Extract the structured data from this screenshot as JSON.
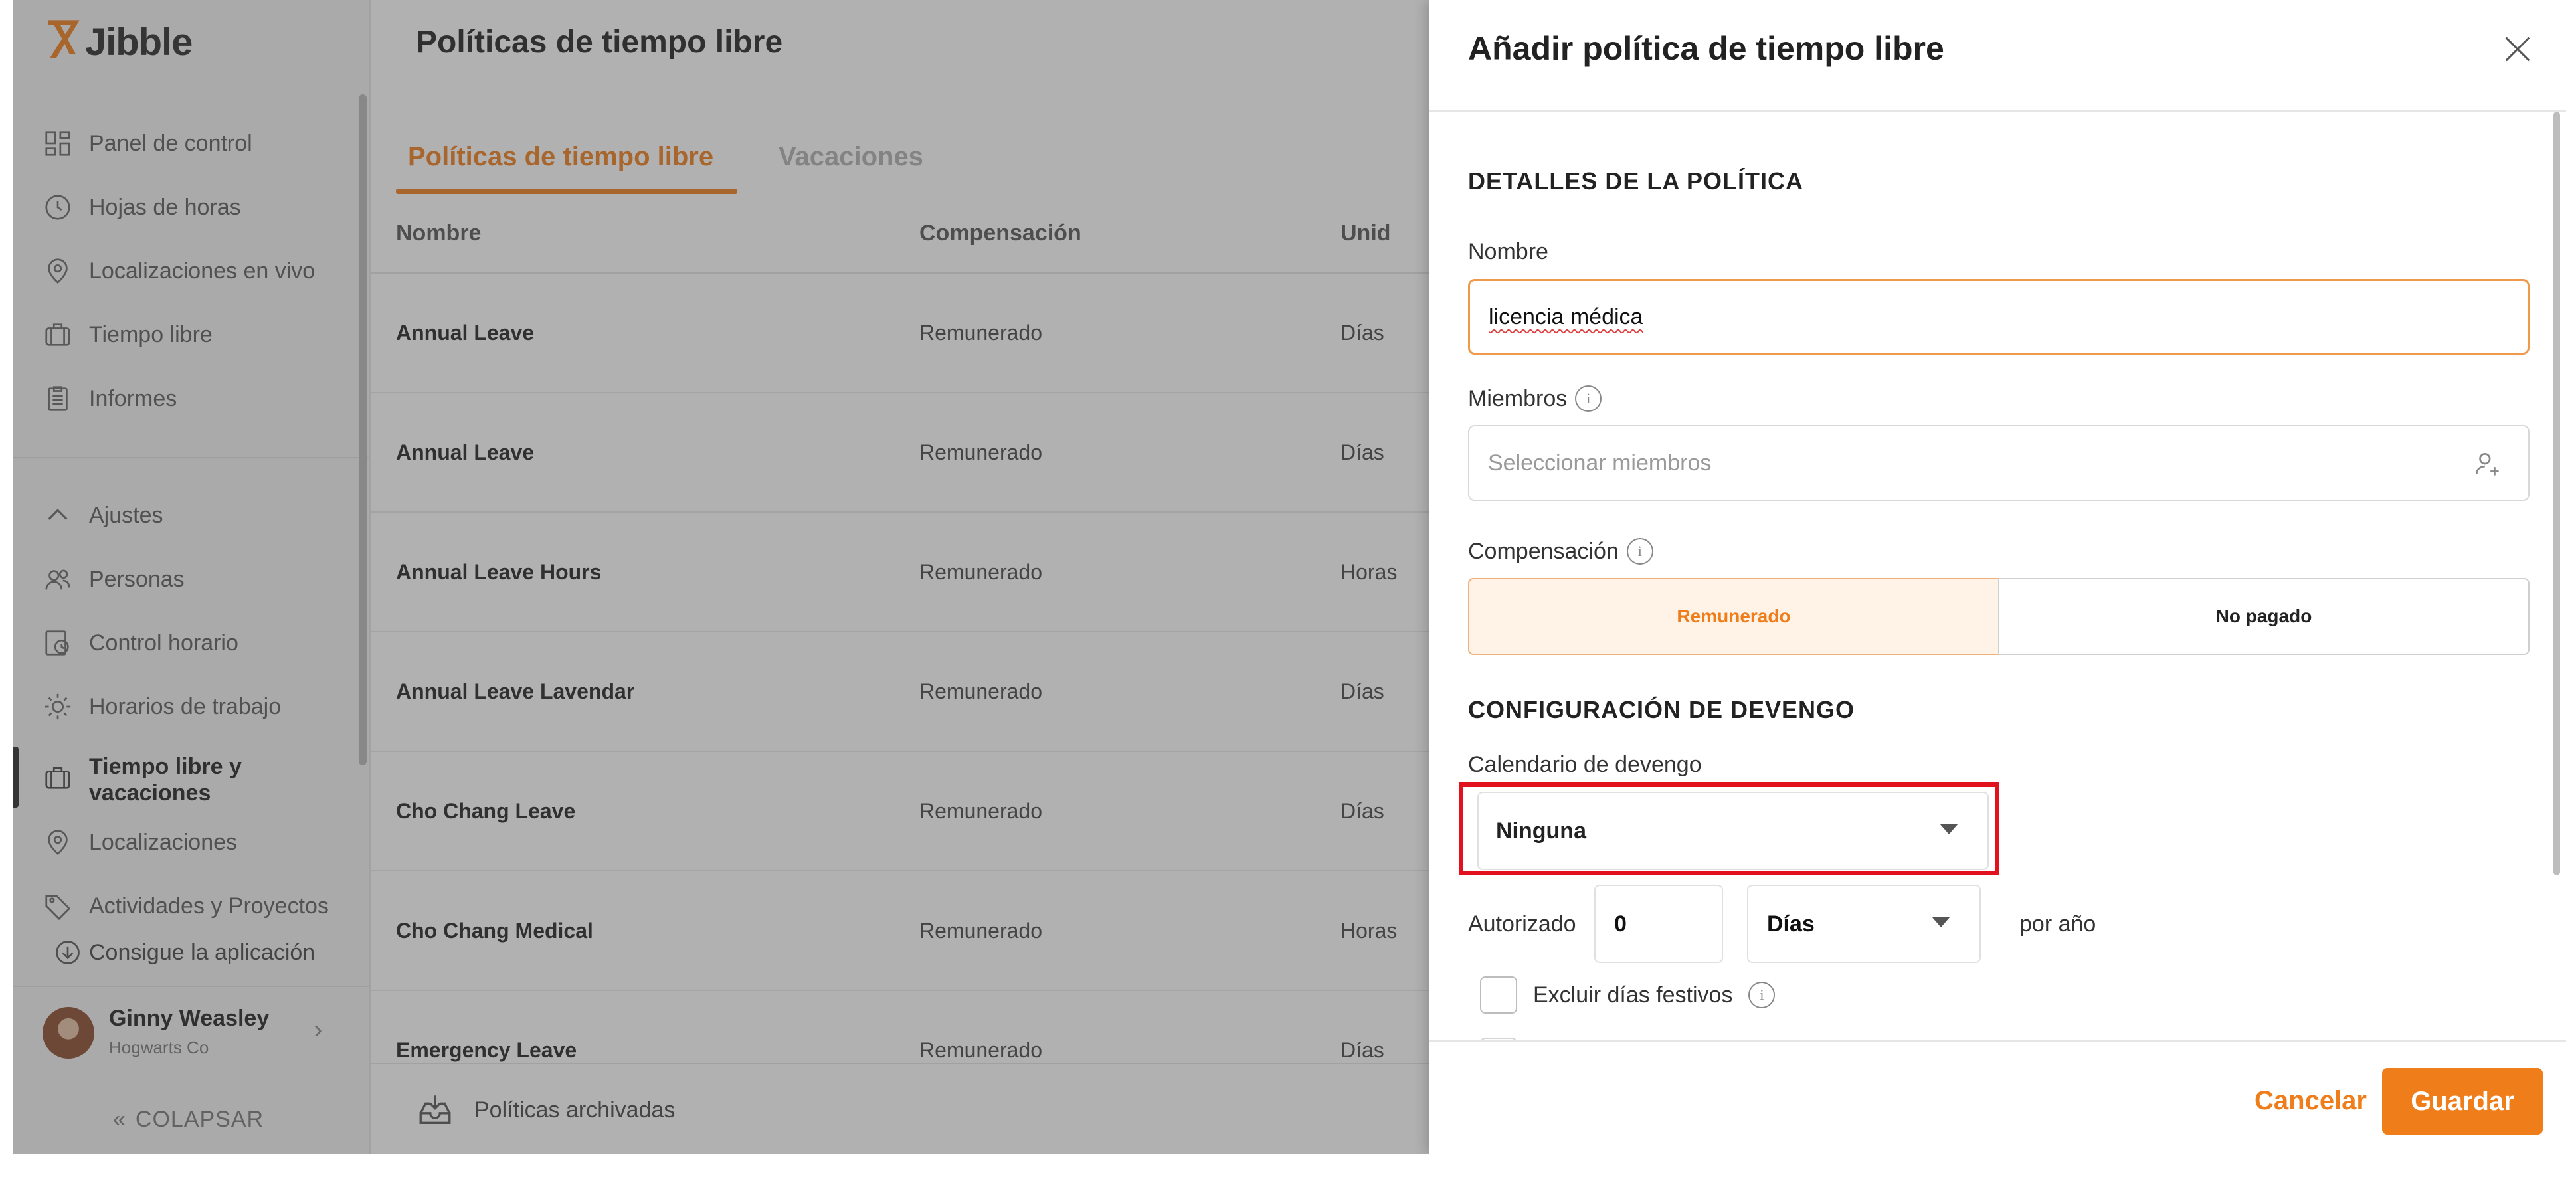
{
  "app": {
    "brand": "Jibble",
    "brand_mark": "Ⴟ"
  },
  "sidebar": {
    "items_top": [
      {
        "label": "Panel de control",
        "icon": "dashboard-icon"
      },
      {
        "label": "Hojas de horas",
        "icon": "clock-icon"
      },
      {
        "label": "Localizaciones en vivo",
        "icon": "location-pin-icon"
      },
      {
        "label": "Tiempo libre",
        "icon": "suitcase-icon"
      },
      {
        "label": "Informes",
        "icon": "clipboard-icon"
      }
    ],
    "settings_label": "Ajustes",
    "items_settings": [
      {
        "label": "Personas",
        "icon": "people-icon"
      },
      {
        "label": "Control horario",
        "icon": "time-tracking-icon"
      },
      {
        "label": "Horarios de trabajo",
        "icon": "sun-schedule-icon"
      },
      {
        "label": "Tiempo libre y vacaciones",
        "label_line1": "Tiempo libre y",
        "label_line2": "vacaciones",
        "icon": "suitcase-icon",
        "active": true
      },
      {
        "label": "Localizaciones",
        "icon": "location-pin-icon"
      },
      {
        "label": "Actividades y Proyectos",
        "icon": "tag-icon"
      }
    ],
    "get_app": "Consigue la aplicación",
    "user": {
      "name": "Ginny Weasley",
      "org": "Hogwarts Co"
    },
    "collapse_label": "COLAPSAR"
  },
  "main": {
    "title": "Políticas de tiempo libre",
    "tabs": [
      {
        "label": "Políticas de tiempo libre",
        "active": true
      },
      {
        "label": "Vacaciones",
        "active": false
      }
    ],
    "columns": [
      "Nombre",
      "Compensación",
      "Unid"
    ],
    "rows": [
      {
        "name": "Annual Leave",
        "comp": "Remunerado",
        "unit": "Días"
      },
      {
        "name": "Annual Leave",
        "comp": "Remunerado",
        "unit": "Días"
      },
      {
        "name": "Annual Leave Hours",
        "comp": "Remunerado",
        "unit": "Horas"
      },
      {
        "name": "Annual Leave Lavendar",
        "comp": "Remunerado",
        "unit": "Días"
      },
      {
        "name": "Cho Chang Leave",
        "comp": "Remunerado",
        "unit": "Días"
      },
      {
        "name": "Cho Chang Medical",
        "comp": "Remunerado",
        "unit": "Horas"
      },
      {
        "name": "Emergency Leave",
        "comp": "Remunerado",
        "unit": "Días"
      }
    ],
    "archived_label": "Políticas archivadas"
  },
  "drawer": {
    "title": "Añadir política de tiempo libre",
    "section_details": "DETALLES DE LA POLÍTICA",
    "name_label": "Nombre",
    "name_value": "licencia médica",
    "members_label": "Miembros",
    "members_placeholder": "Seleccionar miembros",
    "compensation_label": "Compensación",
    "comp_paid": "Remunerado",
    "comp_unpaid": "No pagado",
    "section_accrual": "CONFIGURACIÓN DE DEVENGO",
    "accrual_label": "Calendario de devengo",
    "accrual_value": "Ninguna",
    "authorized_label": "Autorizado",
    "authorized_value": "0",
    "unit_value": "Días",
    "per_year": "por año",
    "exclude_holidays": "Excluir días festivos",
    "cancel": "Cancelar",
    "save": "Guardar"
  },
  "colors": {
    "accent": "#ef7d1a",
    "highlight": "#e1121d"
  }
}
